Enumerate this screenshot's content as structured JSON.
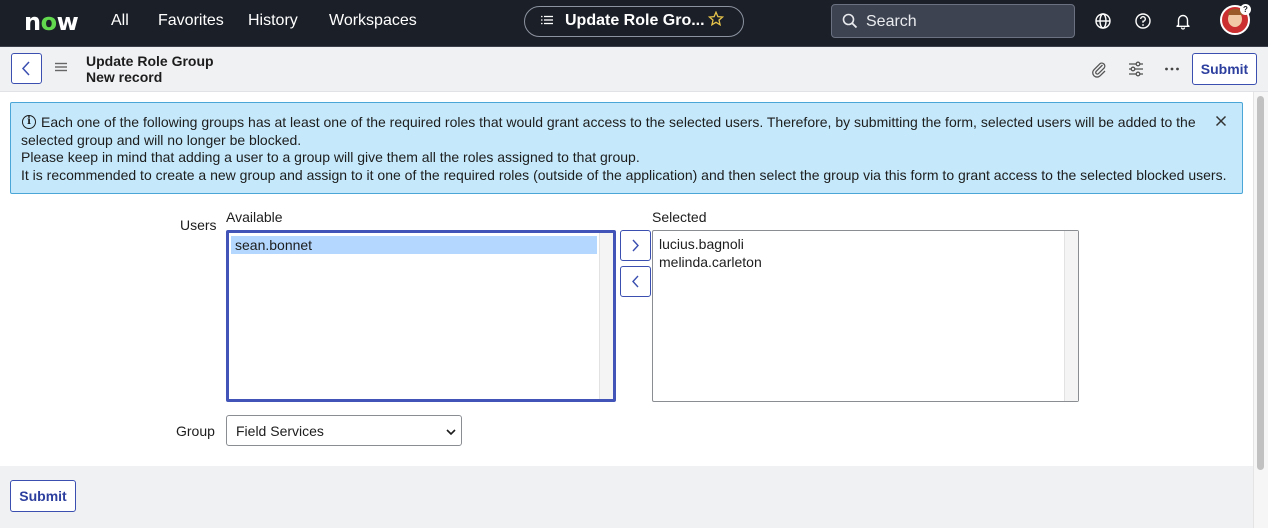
{
  "topnav": {
    "logo": "now",
    "links": [
      "All",
      "Favorites",
      "History",
      "Workspaces"
    ],
    "context_title": "Update Role Gro...",
    "search_label": "Search",
    "avatar_badge": "?"
  },
  "form_header": {
    "title": "Update Role Group",
    "subtitle": "New record",
    "submit_label": "Submit"
  },
  "banner": {
    "lines": [
      "Each one of the following groups has at least one of the required roles that would grant access to the selected users. Therefore, by submitting the form, selected users will be added to the",
      "selected group and will no longer be blocked.",
      "Please keep in mind that adding a user to a group will give them all the roles assigned to that group.",
      "It is recommended to create a new group and assign to it one of the required roles (outside of the application) and then select the group via this form to grant access to the selected blocked users."
    ]
  },
  "form": {
    "users_label": "Users",
    "available_label": "Available",
    "selected_label": "Selected",
    "available_options": [
      "sean.bonnet"
    ],
    "available_highlighted": "sean.bonnet",
    "selected_options": [
      "lucius.bagnoli",
      "melinda.carleton"
    ],
    "group_label": "Group",
    "group_value": "Field Services"
  },
  "footer": {
    "submit_label": "Submit"
  },
  "colors": {
    "nav_bg": "#1b1f27",
    "accent": "#3b4fb0",
    "banner_bg": "#c5e9fb",
    "highlight": "#b3d7ff",
    "logo_green": "#62d84e"
  }
}
